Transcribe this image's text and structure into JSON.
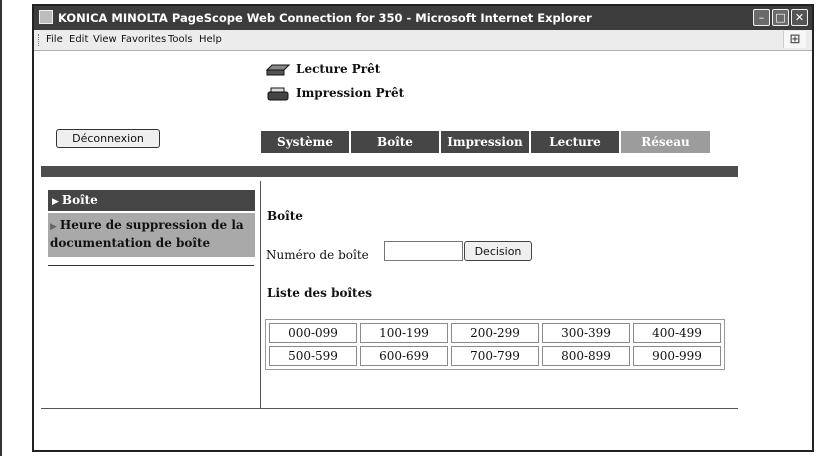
{
  "window": {
    "title": "KONICA MINOLTA PageScope Web Connection for 350 - Microsoft Internet Explorer",
    "menu": [
      "File",
      "Edit",
      "View",
      "Favorites",
      "Tools",
      "Help"
    ]
  },
  "status": [
    {
      "icon": "scanner-icon",
      "text": "Lecture Prêt"
    },
    {
      "icon": "printer-icon",
      "text": "Impression Prêt"
    }
  ],
  "logout_label": "Déconnexion",
  "tabs": [
    "Système",
    "Boîte",
    "Impression",
    "Lecture",
    "Réseau"
  ],
  "sidebar": {
    "items": [
      {
        "label": "Boîte",
        "active": true
      },
      {
        "label": "Heure de suppression de la documentation de boîte",
        "active": false
      }
    ]
  },
  "main": {
    "heading": "Boîte",
    "box_number_label": "Numéro de boîte",
    "box_number_value": "",
    "decision_label": "Decision",
    "list_heading": "Liste des boîtes",
    "ranges": [
      [
        "000-099",
        "100-199",
        "200-299",
        "300-399",
        "400-499"
      ],
      [
        "500-599",
        "600-699",
        "700-799",
        "800-899",
        "900-999"
      ]
    ]
  },
  "colors": {
    "tab_dark": "#464646",
    "tab_network": "#9c9c9c",
    "sidebar_active": "#454545",
    "sidebar_item": "#a9a9a9"
  }
}
